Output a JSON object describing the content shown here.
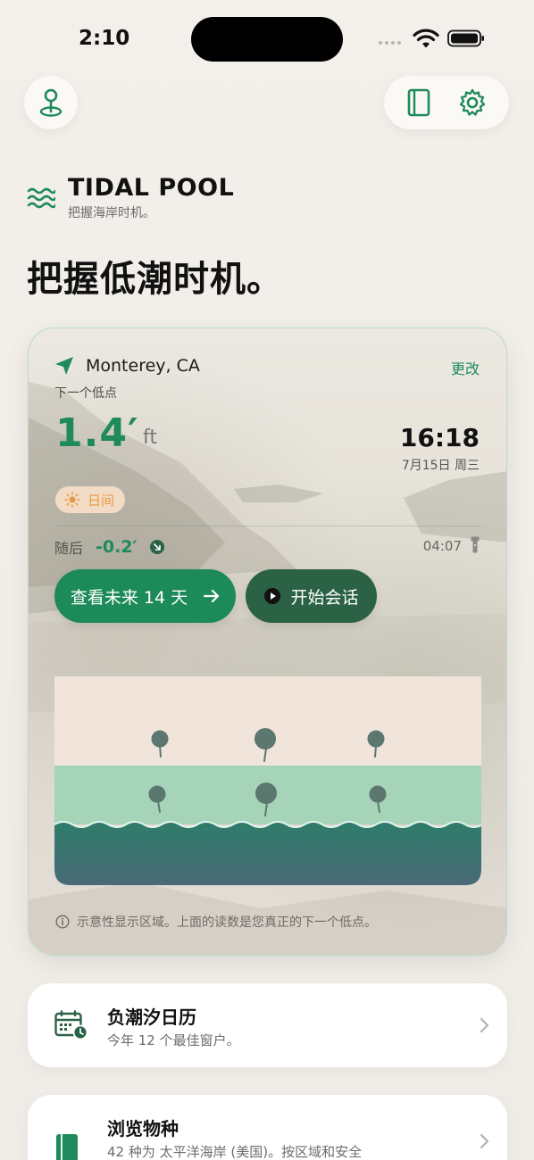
{
  "status": {
    "time": "2:10"
  },
  "brand": {
    "title": "TIDAL POOL",
    "subtitle": "把握海岸时机。"
  },
  "headline": "把握低潮时机。",
  "card": {
    "location": "Monterey, CA",
    "change": "更改",
    "next_low_label": "下一个低点",
    "tide_value": "1.4′",
    "tide_unit": "ft",
    "time": "16:18",
    "date": "7月15日 周三",
    "day_label": "日间",
    "after_label": "随后",
    "after_value": "-0.2′",
    "after_time": "04:07",
    "primary_button": "查看未来 14 天",
    "secondary_button": "开始会话",
    "note": "示意性显示区域。上面的读数是您真正的下一个低点。"
  },
  "list": [
    {
      "title": "负潮汐日历",
      "subtitle": "今年 12 个最佳窗户。"
    },
    {
      "title": "浏览物种",
      "subtitle": "42 种为 太平洋海岸 (美国)。按区域和安全"
    }
  ],
  "colors": {
    "accent": "#1f8a5b",
    "accent_dark": "#2b6246",
    "day_pill_bg": "#f3dcc6",
    "day_pill_fg": "#e69a43",
    "card_border": "#b8dcc9"
  },
  "icons": {
    "top_left": "map-pin-icon",
    "top_right_1": "book-icon",
    "top_right_2": "gear-icon",
    "brand": "waves-icon",
    "location": "location-arrow-icon",
    "day": "sun-icon",
    "after": "arrow-down-right-icon",
    "flashlight": "flashlight-icon",
    "primary": "arrow-right-icon",
    "secondary": "play-icon",
    "note": "info-icon",
    "list_0": "calendar-clock-icon",
    "list_1": "book-icon",
    "chevron": "chevron-right-icon"
  }
}
